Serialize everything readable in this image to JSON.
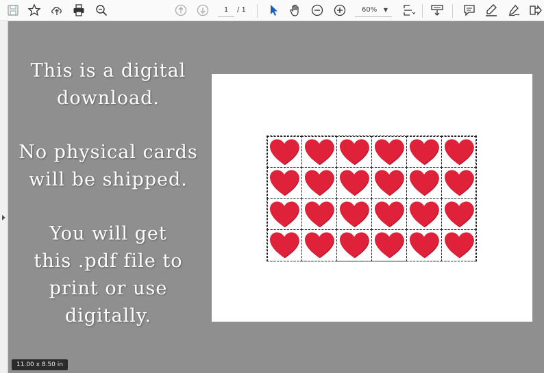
{
  "toolbar": {
    "tools_left": [
      "save-icon",
      "bookmark-star-icon",
      "upload-cloud-icon",
      "print-icon",
      "zoom-search-icon"
    ],
    "page_current": "1",
    "page_separator": "/ 1",
    "zoom_value": "60%",
    "tools_right": [
      "select-cursor-icon",
      "hand-icon",
      "zoom-out-icon",
      "zoom-in-icon",
      "fit-page-icon",
      "scroll-mode-icon",
      "comment-icon",
      "highlight-pen-icon",
      "sign-icon",
      "share-icon"
    ]
  },
  "promo": {
    "line1": "This is a digital",
    "line2": "download.",
    "line3": "No physical cards",
    "line4": "will be shipped.",
    "line5": "You will get",
    "line6": "this .pdf file to",
    "line7": "print or use",
    "line8": "digitally."
  },
  "document": {
    "grid_rows": 4,
    "grid_cols": 6,
    "card_icon": "heart-icon",
    "heart_color": "#e0213a"
  },
  "status": {
    "page_size": "11.00 x 8.50 in"
  }
}
